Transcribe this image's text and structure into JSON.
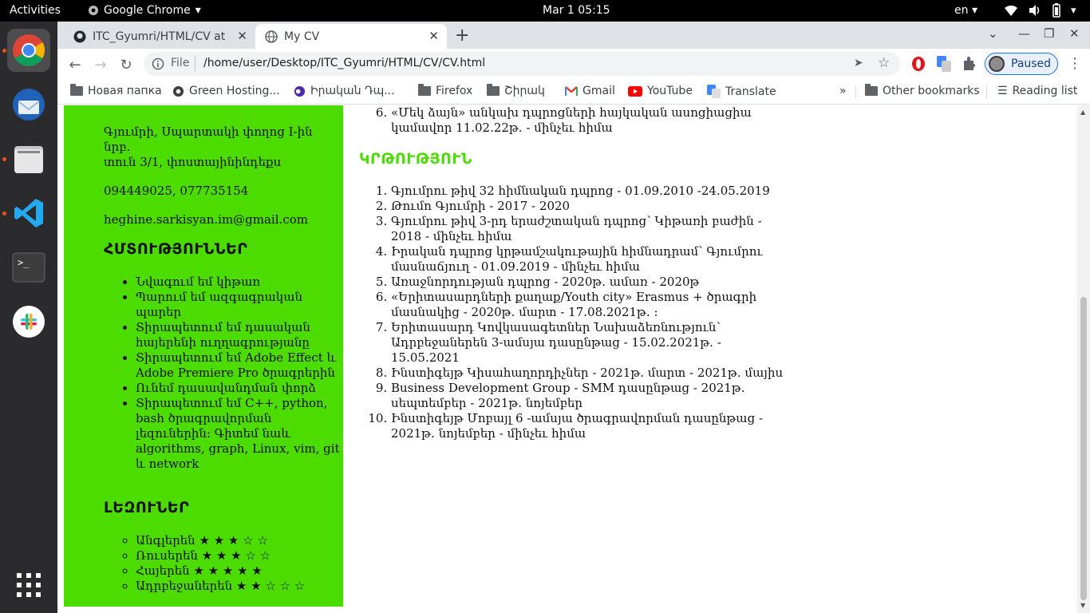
{
  "topbar": {
    "activities": "Activities",
    "app": "Google Chrome",
    "clock": "Mar 1  05:15",
    "lang": "en"
  },
  "dock": {
    "items": [
      "chrome-icon",
      "thunderbird-icon",
      "files-icon",
      "vscode-icon",
      "terminal-icon",
      "slack-icon",
      "show-apps-icon"
    ]
  },
  "browser": {
    "tabs": [
      {
        "title": "ITC_Gyumri/HTML/CV at master",
        "icon": "github-icon"
      },
      {
        "title": "My CV",
        "icon": "globe-icon"
      }
    ],
    "omnibox": {
      "scheme": "File",
      "url": "/home/user/Desktop/ITC_Gyumri/HTML/CV/CV.html"
    },
    "profile_status": "Paused",
    "bookmarks": [
      {
        "label": "Новая папка",
        "icon": "folder-icon"
      },
      {
        "label": "Green Hosting...",
        "icon": "globe-icon"
      },
      {
        "label": "Իրական Դպ...",
        "icon": "site-icon"
      },
      {
        "label": "Firefox",
        "icon": "folder-icon"
      },
      {
        "label": "Շիրակ",
        "icon": "folder-icon"
      },
      {
        "label": "Gmail",
        "icon": "gmail-icon"
      },
      {
        "label": "YouTube",
        "icon": "youtube-icon"
      },
      {
        "label": "Translate",
        "icon": "translate-icon"
      }
    ],
    "more_bookmarks": "»",
    "other_bookmarks": "Other bookmarks",
    "reading_list": "Reading list"
  },
  "cv": {
    "sidebar": {
      "address_line1": "Գյումրի, Սպարտակի փողոց I-ին նրբ.",
      "address_line2": "տուն 3/1, փոստայինինդեքս",
      "phone": "094449025, 077735154",
      "email": "heghine.sarkisyan.im@gmail.com",
      "hobbies_title": "ՀՄՏՈՒԹՅՈՒՆՆԵՐ",
      "hobbies": [
        "Նվագում եմ կիթառ",
        "Պարում եմ ազգագրական պարեր",
        "Տիրապետում եմ դասական հայերենի ուղղագրությանը",
        "Տիրապետում եմ Adobe Effect և Adobe Premiere Pro ծրագրերին",
        "Ունեմ դասավանդման փորձ",
        "Տիրապետում եմ C++, python, bash ծրագրավորման լեզուներին: Գիտեմ նաև algorithms, graph, Linux, vim, git և network"
      ],
      "languages_title": "ԼԵԶՈՒՆԵՐ",
      "languages": [
        "Անգլերեն ★ ★ ★ ☆ ☆",
        "Ռուսերեն ★ ★ ★ ☆ ☆",
        "Հայերեն ★ ★ ★ ★ ★",
        "Ադրբեջաներեն ★ ★ ☆ ☆ ☆"
      ]
    },
    "experience_last": "«Մեկ ձայն» անկախ դպրոցների հայկական ասոցիացիա կամավոր 11.02.22թ. - մինչեւ հիմա",
    "education_title": "ԿՐԹՈՒԹՅՈՒՆ",
    "education": [
      "Գյումրու թիվ 32 հիմնական դպրոց - 01.09.2010 -24.05.2019",
      "Թումո Գյումրի - 2017 - 2020",
      "Գյումրու թիվ 3-րդ երաժշտական դպրոց՝ Կիթառի բաժին - 2018 - մինչեւ հիմա",
      "Իրական դպրոց կրթամշակութային հիմնադրամ՝ Գյումրու մասնաճյուղ - 01.09.2019 - մինչեւ հիմա",
      "Առաջնորդության դպրոց - 2020թ. ամառ - 2020թ",
      "«Երիտասարդների քաղաք/Youth city» Erasmus + ծրագրի մասնակից - 2020թ. մարտ - 17.08.2021թ. :",
      "Երիտասարդ Կովկասագետներ Նախաձեռնություն՝ Ադրբեջաներեն 3-ամսյա դասընթաց - 15.02.2021թ. - 15.05.2021",
      "Ինստիգեյթ Կիսահաղորդիչներ - 2021թ. մարտ - 2021թ. մայիս",
      "Business Development Group - SMM դասընթաց - 2021թ. սեպտեմբեր - 2021թ. նոյեմբեր",
      "Ինստիգեյթ Մոբայլ 6 -ամսյա ծրագրավորման դասընթաց - 2021թ. նոյեմբեր - մինչեւ հիմա"
    ]
  }
}
